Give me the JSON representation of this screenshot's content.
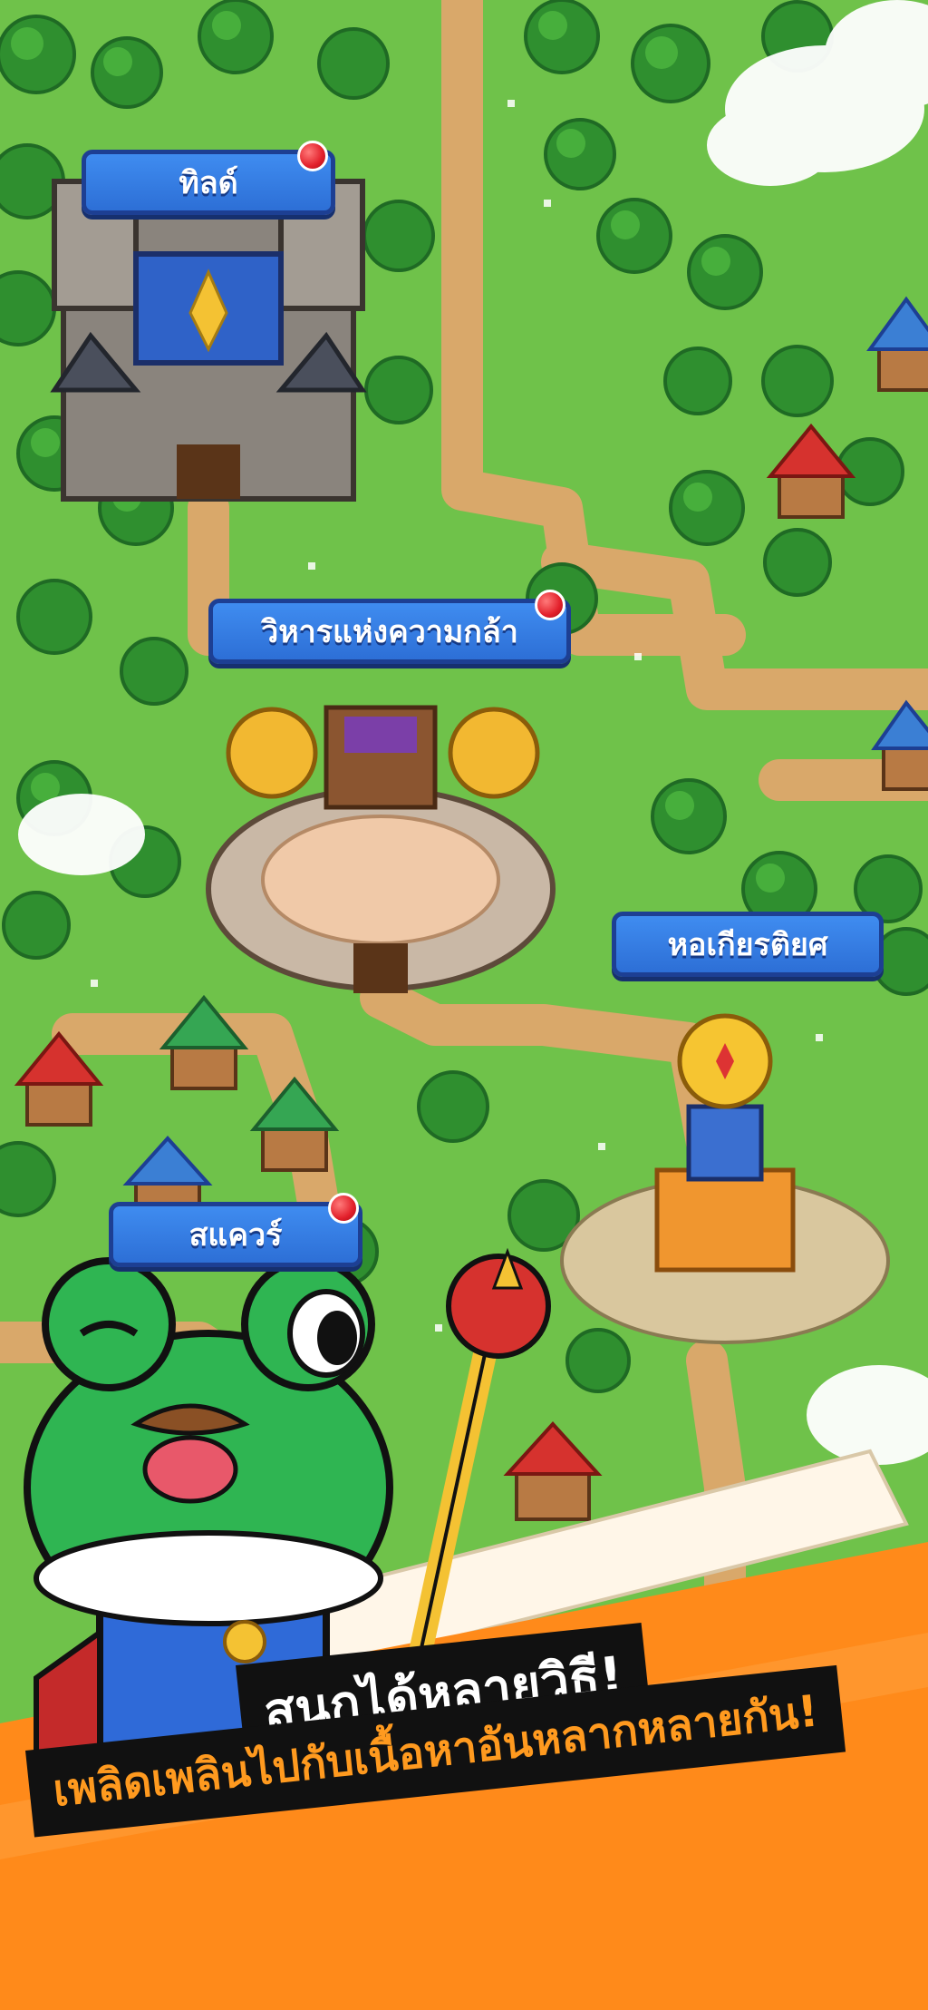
{
  "buildings": {
    "guild": {
      "label": "ทิลด์",
      "has_notification": true
    },
    "hall_of_courage": {
      "label": "วิหารแห่งความกล้า",
      "has_notification": true
    },
    "hall_of_honor": {
      "label": "หอเกียรติยศ",
      "has_notification": false
    },
    "square": {
      "label": "สแควร์",
      "has_notification": true
    }
  },
  "promo": {
    "headline": "สนุกได้หลายวิธี!",
    "subline": "เพลิดเพลินไปกับเนื้อหาอันหลากหลายกัน!"
  },
  "colors": {
    "grass": "#6fc24a",
    "path": "#d8a868",
    "label_blue": "#2f74df",
    "accent_orange": "#ff8a1a"
  },
  "icons": [
    "notification-dot-icon",
    "crown-scepter-icon",
    "frog-king-mascot"
  ]
}
